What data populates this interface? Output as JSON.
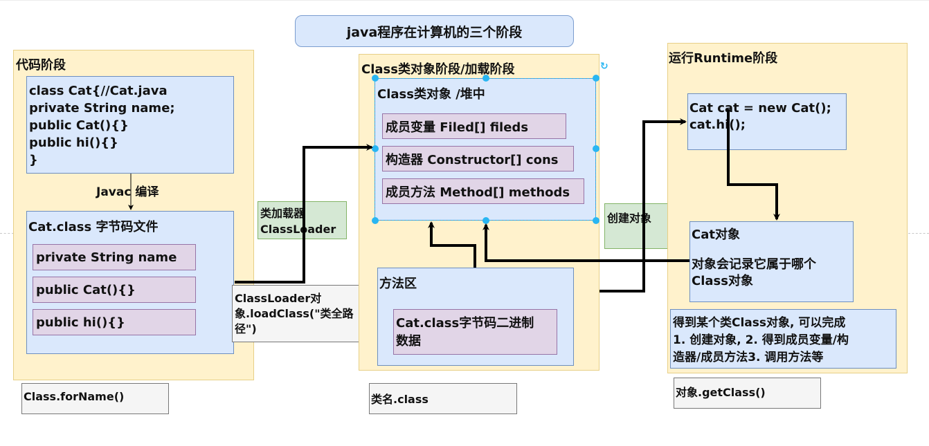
{
  "diagram": {
    "title": "java程序在计算机的三个阶段",
    "colors": {
      "stage_fill": "#fff2cc",
      "box_blue": "#dae8fc",
      "box_purple": "#e1d5e7",
      "box_green": "#d5e8d4",
      "box_gray": "#f5f5f5",
      "selection": "#29b6f2",
      "arrow": "#000000"
    },
    "code_stage": {
      "title": "代码阶段",
      "source_lines": [
        "class Cat{//Cat.java",
        "private String name;",
        "public Cat(){}",
        "public hi(){}",
        "}"
      ],
      "compile_label": "Javac 编译",
      "bytecode_file": {
        "title": "Cat.class 字节码文件",
        "members": [
          "private String name",
          "public Cat(){}",
          "public hi(){}"
        ]
      },
      "api_note": "Class.forName()"
    },
    "classloader": {
      "label_line1": "类加载器",
      "label_line2": "ClassLoader",
      "note_line1": "ClassLoader对",
      "note_line2": "象.loadClass(\"类全路",
      "note_line3": "径\")"
    },
    "class_stage": {
      "title": "Class类对象阶段/加载阶段",
      "class_object": {
        "title": "Class类对象 /堆中",
        "members": [
          "成员变量  Filed[] fileds",
          "构造器 Constructor[] cons",
          "成员方法 Method[] methods"
        ]
      },
      "method_area": {
        "title": "方法区",
        "content_line1": "Cat.class字节码二进制",
        "content_line2": "数据"
      },
      "api_note": "类名.class"
    },
    "create_object_label": "创建对象",
    "runtime_stage": {
      "title": "运行Runtime阶段",
      "code_lines": [
        "Cat cat = new Cat();",
        "cat.hi();"
      ],
      "object_box": {
        "title": "Cat对象",
        "desc_line1": "对象会记录它属于哪个",
        "desc_line2": "Class对象"
      },
      "summary_line1": "得到某个类Class对象, 可以完成",
      "summary_line2": "1. 创建对象, 2. 得到成员变量/构",
      "summary_line3": "造器/成员方法3. 调用方法等",
      "api_note": "对象.getClass()"
    }
  }
}
